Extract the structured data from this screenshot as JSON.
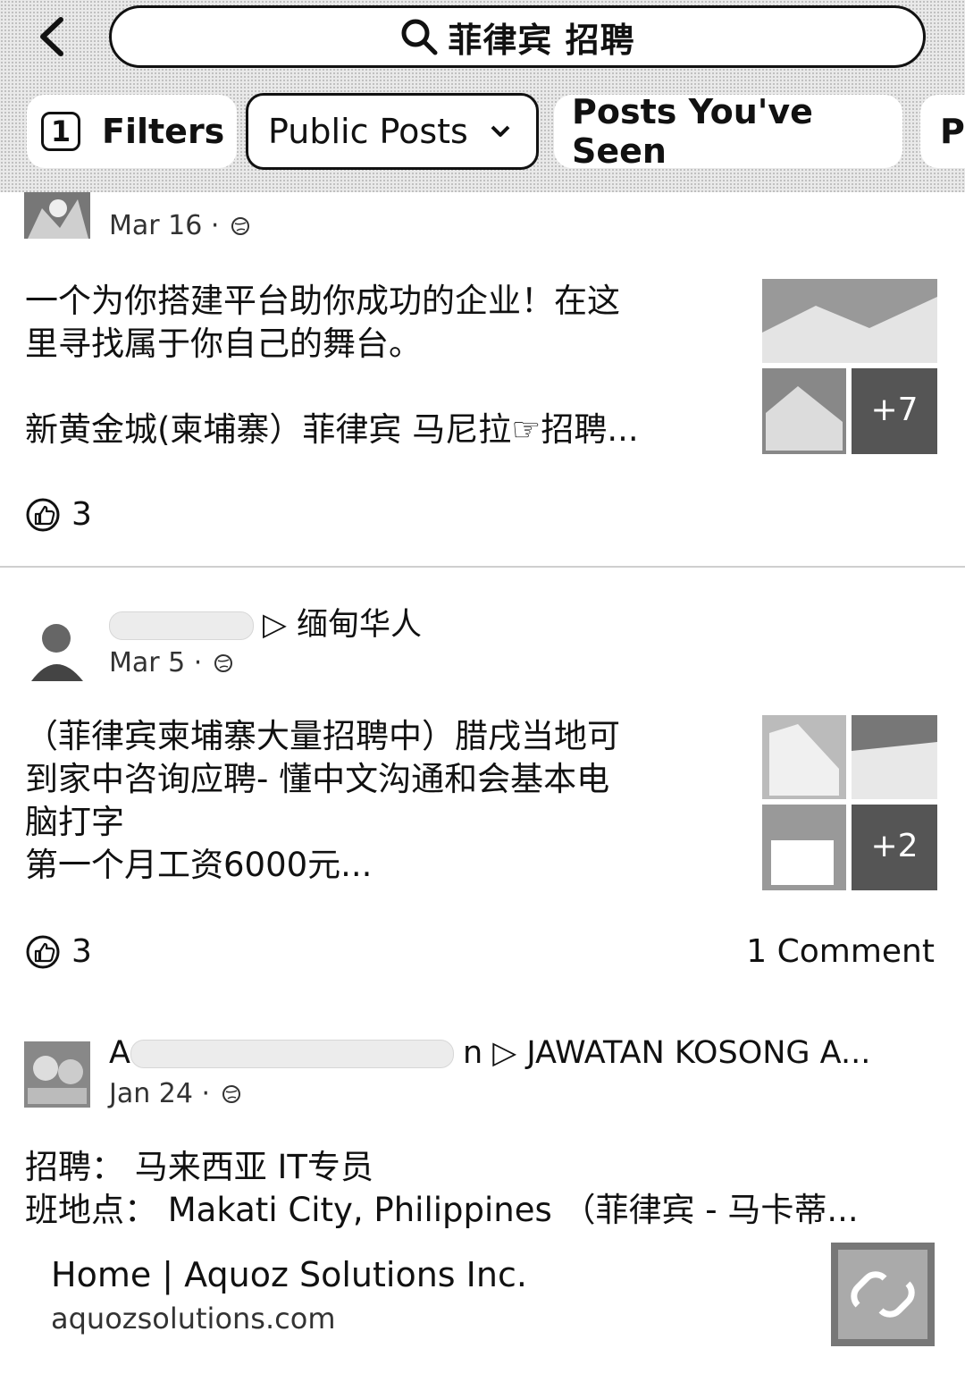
{
  "search": {
    "query": "菲律宾 招聘"
  },
  "filters": {
    "count": "1",
    "filters_label": "Filters",
    "public_posts_label": "Public Posts",
    "posts_seen_label": "Posts You've Seen",
    "next_chip_label": "P"
  },
  "posts": [
    {
      "date": "Mar 16 ·",
      "text": "一个为你搭建平台助你成功的企业！在这\n里寻找属于你自己的舞台。\n\n新黄金城(柬埔寨）菲律宾 马尼拉☞招聘...",
      "likes": "3",
      "more_images": "+7"
    },
    {
      "group": "▷ 缅甸华人",
      "date": "Mar 5 ·",
      "text": "（菲律宾柬埔寨大量招聘中）腊戌当地可\n到家中咨询应聘- 懂中文沟通和会基本电\n脑打字\n第一个月工资6000元...",
      "likes": "3",
      "comments": "1 Comment",
      "more_images": "+2"
    },
    {
      "author_partial": "A",
      "author_partial_end": "n",
      "group": "▷ JAWATAN KOSONG A...",
      "date": "Jan 24 ·",
      "text": "招聘： 马来西亚 IT专员\n班地点： Makati City, Philippines （菲律宾 - 马卡蒂...",
      "link_title": "Home | Aquoz Solutions Inc.",
      "link_url": "aquozsolutions.com"
    }
  ]
}
